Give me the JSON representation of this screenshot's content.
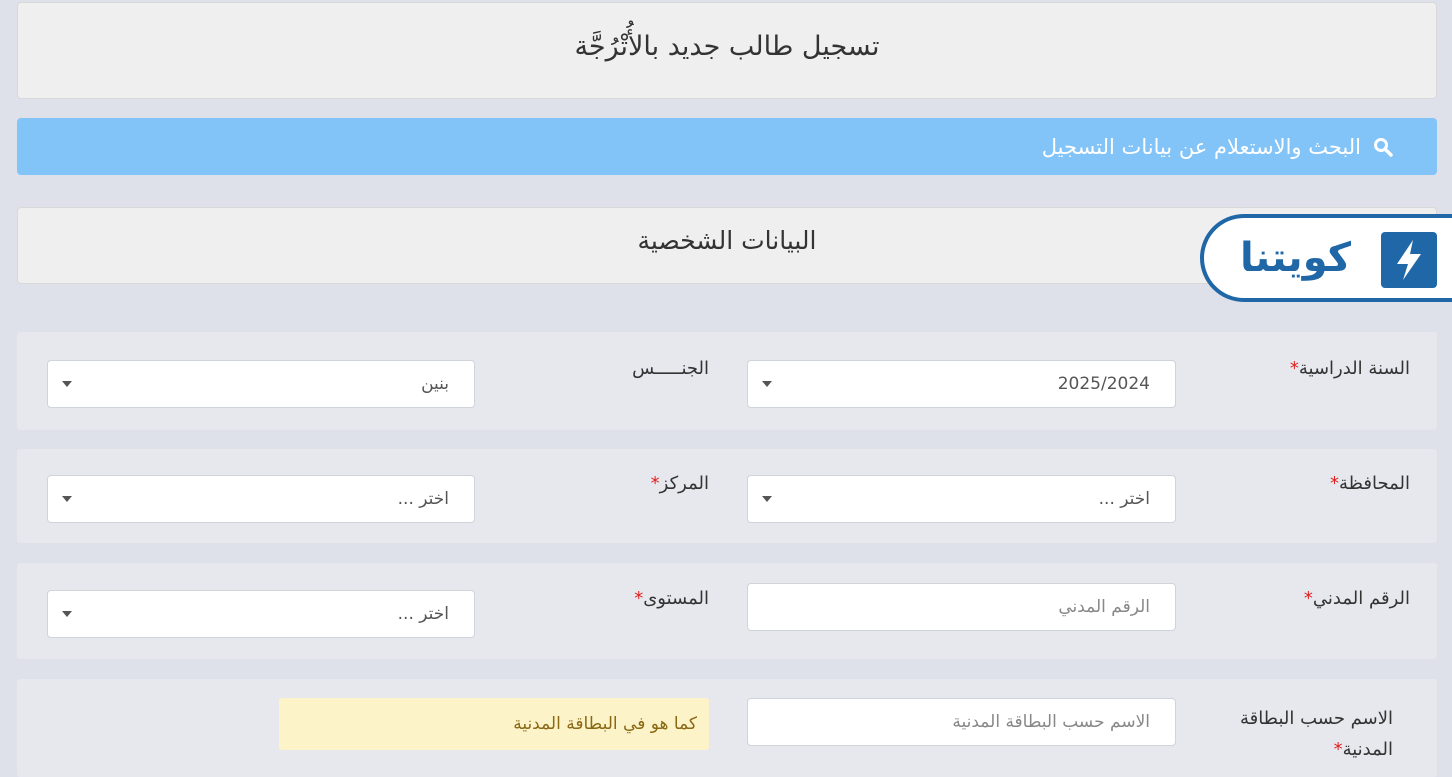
{
  "header": {
    "title": "تسجيل طالب جديد بالأُتْرُجَّة"
  },
  "search_bar": {
    "label": "البحث والاستعلام عن بيانات التسجيل",
    "icon": "search-icon"
  },
  "section": {
    "title": "البيانات الشخصية"
  },
  "logo": {
    "text": "كويتنا"
  },
  "required_mark": "*",
  "form": {
    "academic_year": {
      "label": "السنة الدراسية",
      "value": "2025/2024"
    },
    "gender": {
      "label": "الجنـــــس",
      "value": "بنين"
    },
    "governorate": {
      "label": "المحافظة",
      "value": "اختر ..."
    },
    "center": {
      "label": "المركز",
      "value": "اختر ..."
    },
    "civil_id": {
      "label": "الرقم المدني",
      "placeholder": "الرقم المدني"
    },
    "level": {
      "label": "المستوى",
      "value": "اختر ..."
    },
    "name": {
      "label": "الاسم حسب البطاقة المدنية",
      "placeholder": "الاسم حسب البطاقة المدنية",
      "hint": "كما هو في البطاقة المدنية"
    }
  },
  "colors": {
    "search_bar": "#82c3f8",
    "brand": "#1f67a6",
    "required": "#e02020",
    "hint_bg": "#fdf3c8"
  }
}
